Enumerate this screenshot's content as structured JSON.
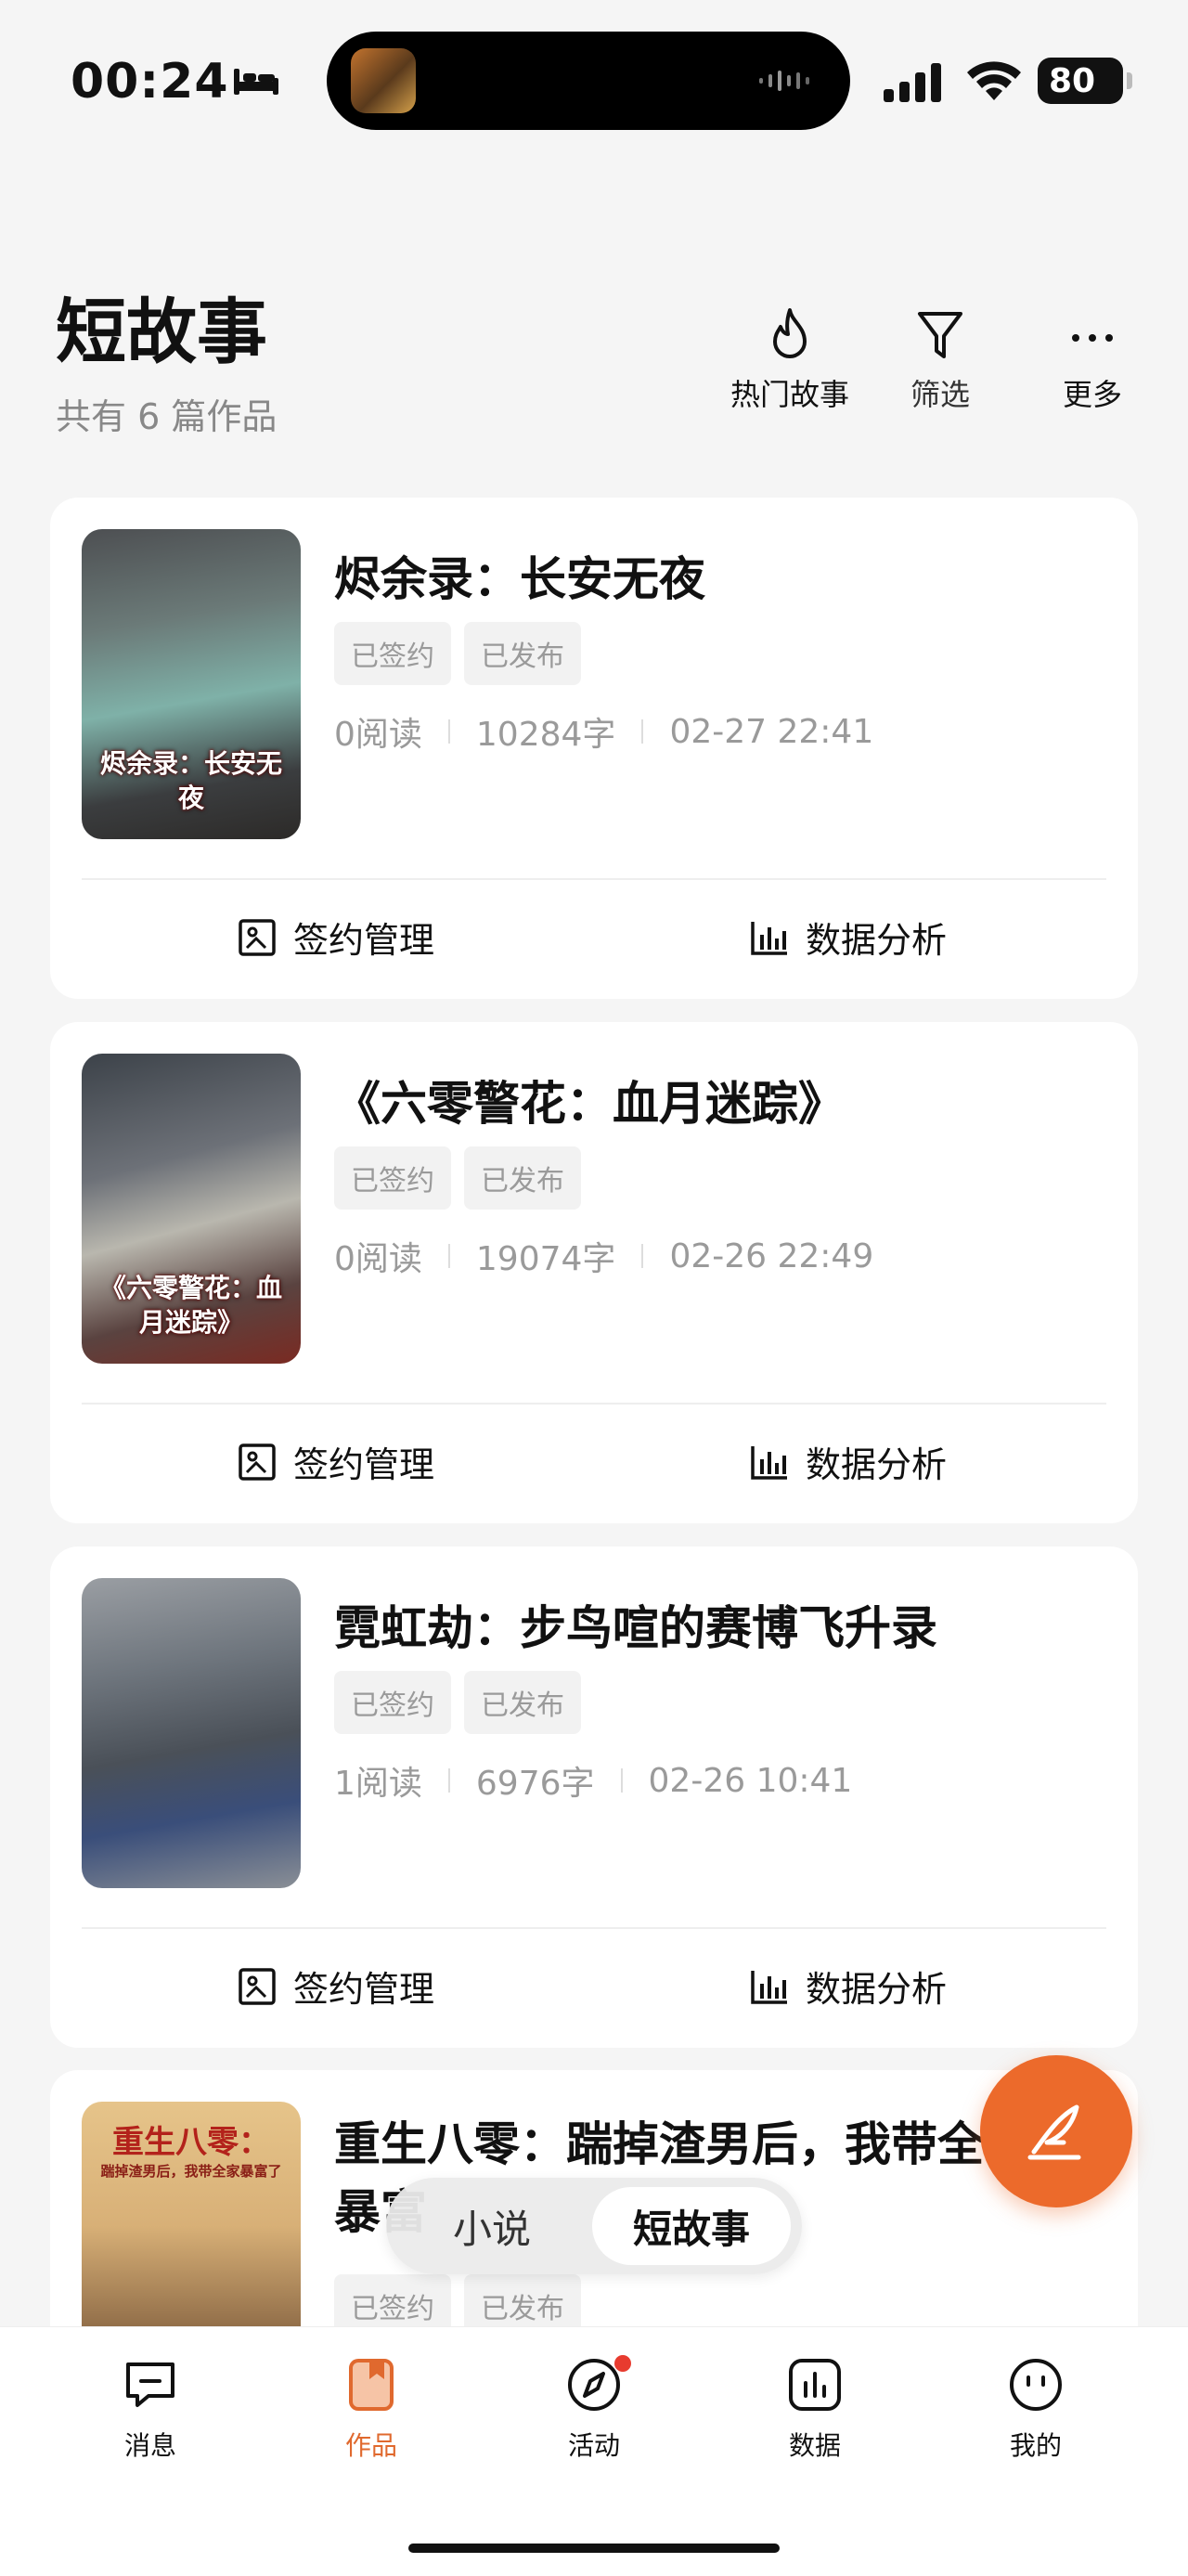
{
  "status_bar": {
    "time": "00:24",
    "battery": "80"
  },
  "header": {
    "title": "短故事",
    "count": "共有 6 篇作品",
    "actions": [
      {
        "label": "热门故事",
        "icon": "flame-icon"
      },
      {
        "label": "筛选",
        "icon": "filter-icon"
      },
      {
        "label": "更多",
        "icon": "more-icon"
      }
    ]
  },
  "works": [
    {
      "title": "烬余录：长安无夜",
      "cover_text": "烬余录：长安无夜",
      "tags": [
        "已签约",
        "已发布"
      ],
      "reads": "0阅读",
      "words": "10284字",
      "date": "02-27 22:41",
      "actions": {
        "sign": "签约管理",
        "data": "数据分析"
      }
    },
    {
      "title": "《六零警花：血月迷踪》",
      "cover_text": "《六零警花：血月迷踪》",
      "tags": [
        "已签约",
        "已发布"
      ],
      "reads": "0阅读",
      "words": "19074字",
      "date": "02-26 22:49",
      "actions": {
        "sign": "签约管理",
        "data": "数据分析"
      }
    },
    {
      "title": "霓虹劫：步鸟喧的赛博飞升录",
      "cover_text": "",
      "tags": [
        "已签约",
        "已发布"
      ],
      "reads": "1阅读",
      "words": "6976字",
      "date": "02-26 10:41",
      "actions": {
        "sign": "签约管理",
        "data": "数据分析"
      }
    },
    {
      "title": "重生八零：踹掉渣男后，我带全家暴富",
      "cover_text": "重生八零：",
      "cover_sub": "踹掉渣男后，我带全家暴富了",
      "tags": [
        "已签约",
        "已发布"
      ]
    }
  ],
  "toggle": {
    "novel": "小说",
    "short": "短故事"
  },
  "nav": [
    {
      "label": "消息",
      "icon": "message-icon"
    },
    {
      "label": "作品",
      "icon": "works-icon"
    },
    {
      "label": "活动",
      "icon": "compass-icon"
    },
    {
      "label": "数据",
      "icon": "chart-icon"
    },
    {
      "label": "我的",
      "icon": "profile-icon"
    }
  ],
  "colors": {
    "accent": "#ec6a2b",
    "badge": "#e83b2f",
    "background": "#f5f5f5"
  }
}
